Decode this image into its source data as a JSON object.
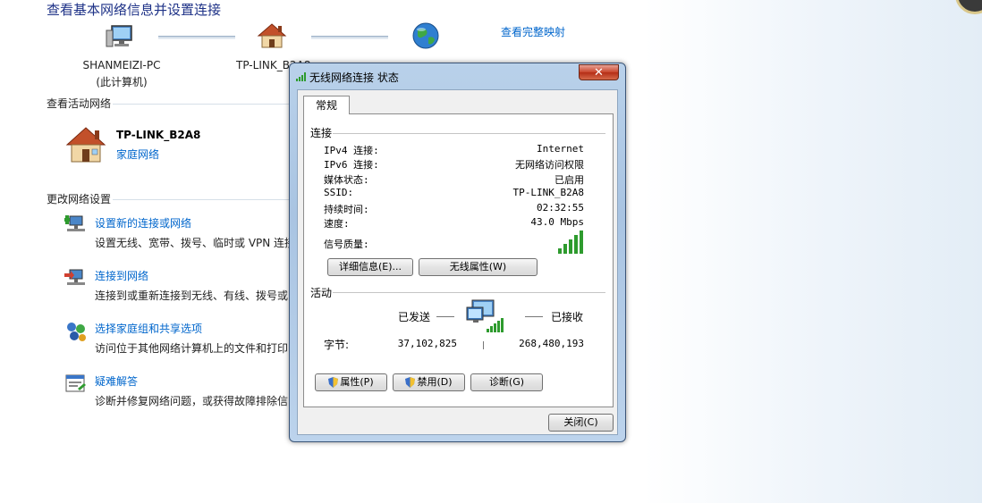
{
  "page": {
    "heading": "查看基本网络信息并设置连接",
    "full_map_link": "查看完整映射"
  },
  "map": {
    "nodes": [
      {
        "label": "SHANMEIZI-PC",
        "sublabel": "(此计算机)",
        "icon": "computer-icon"
      },
      {
        "label": "TP-LINK_B2A8",
        "sublabel": "",
        "icon": "house-icon"
      },
      {
        "label": "",
        "sublabel": "",
        "icon": "globe-icon"
      }
    ]
  },
  "active": {
    "title": "查看活动网络",
    "network_name": "TP-LINK_B2A8",
    "network_type": "家庭网络"
  },
  "change": {
    "title": "更改网络设置",
    "tasks": [
      {
        "link": "设置新的连接或网络",
        "desc": "设置无线、宽带、拨号、临时或 VPN 连接",
        "icon": "new-connection-icon"
      },
      {
        "link": "连接到网络",
        "desc": "连接到或重新连接到无线、有线、拨号或",
        "icon": "connect-network-icon"
      },
      {
        "link": "选择家庭组和共享选项",
        "desc": "访问位于其他网络计算机上的文件和打印",
        "icon": "homegroup-icon"
      },
      {
        "link": "疑难解答",
        "desc": "诊断并修复网络问题，或获得故障排除信",
        "icon": "troubleshoot-icon"
      }
    ]
  },
  "dialog": {
    "title": "无线网络连接 状态",
    "close_glyph": "✕",
    "tab": "常规",
    "connection_group": "连接",
    "fields": [
      {
        "label": "IPv4 连接:",
        "value": "Internet"
      },
      {
        "label": "IPv6 连接:",
        "value": "无网络访问权限"
      },
      {
        "label": "媒体状态:",
        "value": "已启用"
      },
      {
        "label": "SSID:",
        "value": "TP-LINK_B2A8"
      },
      {
        "label": "持续时间:",
        "value": "02:32:55"
      },
      {
        "label": "速度:",
        "value": "43.0 Mbps"
      }
    ],
    "signal_label": "信号质量:",
    "signal_bars": 5,
    "details_button": "详细信息(E)...",
    "wireless_props_button": "无线属性(W)",
    "activity_group": "活动",
    "sent_label": "已发送",
    "received_label": "已接收",
    "bytes_label": "字节:",
    "bytes_sent": "37,102,825",
    "bytes_received": "268,480,193",
    "properties_button": "属性(P)",
    "disable_button": "禁用(D)",
    "diagnose_button": "诊断(G)",
    "close_button": "关闭(C)"
  },
  "colors": {
    "link": "#0066cc",
    "heading": "#1e3287",
    "signal": "#2e9b2e"
  }
}
